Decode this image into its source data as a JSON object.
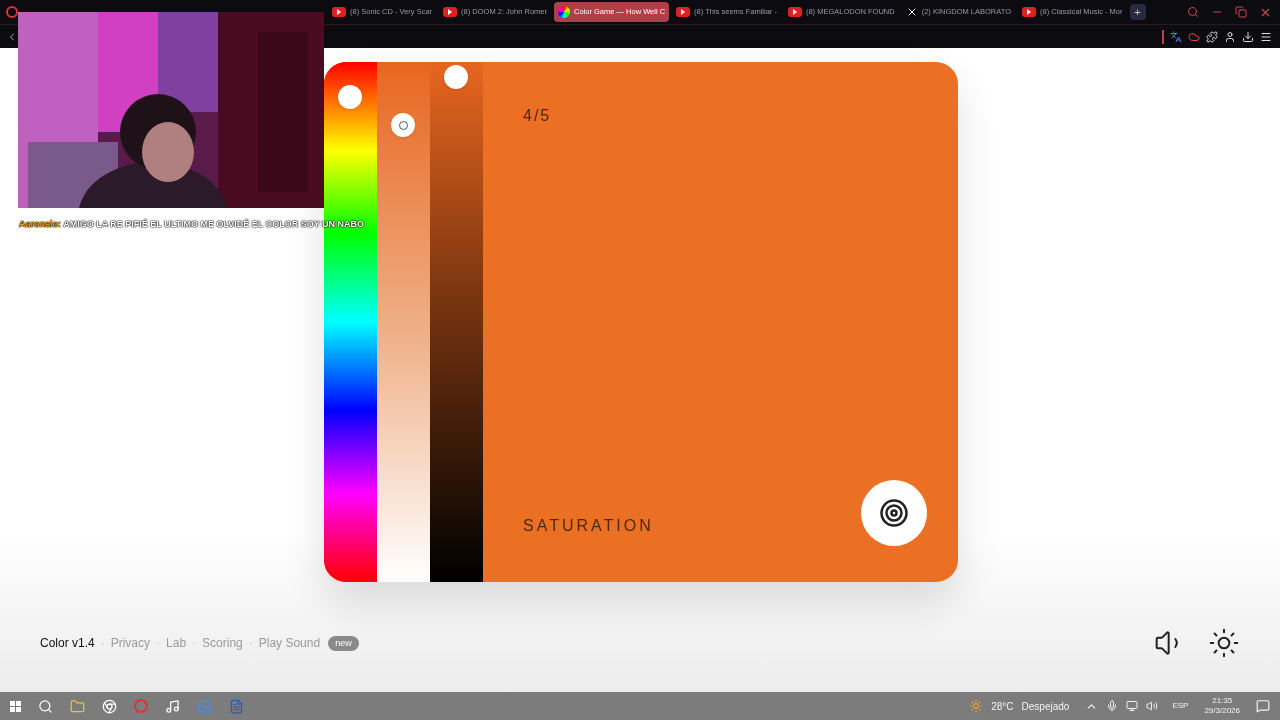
{
  "browser": {
    "tabs": [
      {
        "title": "(8) Sonic CD - Very Scar",
        "kind": "youtube",
        "selected": false
      },
      {
        "title": "(8) DOOM 2: John Romer",
        "kind": "youtube",
        "selected": false
      },
      {
        "title": "Color Game — How Well C",
        "kind": "site",
        "selected": true
      },
      {
        "title": "(8) This seems Familiar -",
        "kind": "youtube",
        "selected": false
      },
      {
        "title": "(8) MEGALODON FOUND",
        "kind": "youtube",
        "selected": false
      },
      {
        "title": "(2) KINGDOM LABORATO",
        "kind": "x",
        "selected": false
      },
      {
        "title": "(8) Classical Music - Mor",
        "kind": "youtube",
        "selected": false
      }
    ],
    "new_tab": "+"
  },
  "stream": {
    "chat": {
      "user": "Aaronsio:",
      "message": "AMIGO LA RE PIFIÉ EL ULTIMO ME OLVIDÉ EL COLOR SOY UN NABO"
    }
  },
  "game": {
    "round": "4/5",
    "sliders": [
      {
        "kind": "hue"
      },
      {
        "kind": "saturation"
      },
      {
        "kind": "lightness"
      }
    ],
    "color": "#ec7023",
    "mode": "SATURATION"
  },
  "footer": {
    "links": [
      {
        "label": "Color v1.4",
        "selected": true
      },
      {
        "label": "Privacy",
        "selected": false
      },
      {
        "label": "Lab",
        "selected": false
      },
      {
        "label": "Scoring",
        "selected": false
      },
      {
        "label": "Play Sound",
        "selected": false
      }
    ],
    "separator": "·",
    "badge": "new"
  },
  "taskbar": {
    "weather": {
      "temp": "28°C",
      "condition": "Despejado"
    },
    "language": "ESP",
    "time": "21:35",
    "date": "29/3/2026"
  }
}
